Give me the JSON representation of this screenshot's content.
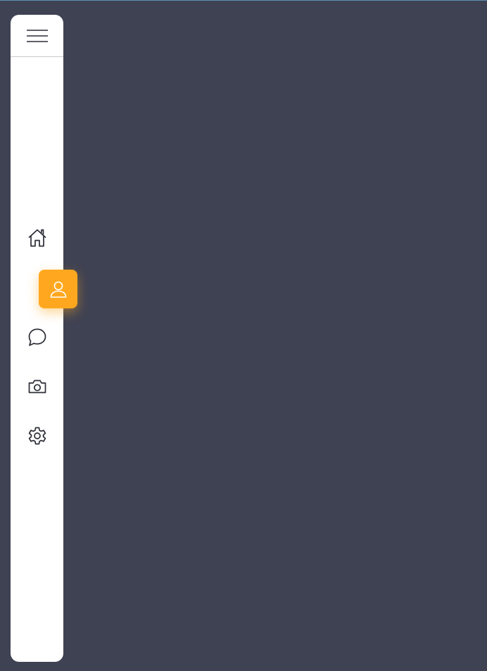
{
  "colors": {
    "background": "#3f4253",
    "sidebar": "#ffffff",
    "accent": "#ffa81f",
    "icon_stroke": "#2b2d36"
  },
  "sidebar": {
    "menu_icon": "hamburger-menu-icon",
    "items": [
      {
        "icon": "home-icon",
        "label": "",
        "active": false
      },
      {
        "icon": "user-icon",
        "label": "",
        "active": true
      },
      {
        "icon": "chat-bubble-icon",
        "label": "",
        "active": false
      },
      {
        "icon": "camera-icon",
        "label": "",
        "active": false
      },
      {
        "icon": "gear-icon",
        "label": "",
        "active": false
      }
    ]
  }
}
